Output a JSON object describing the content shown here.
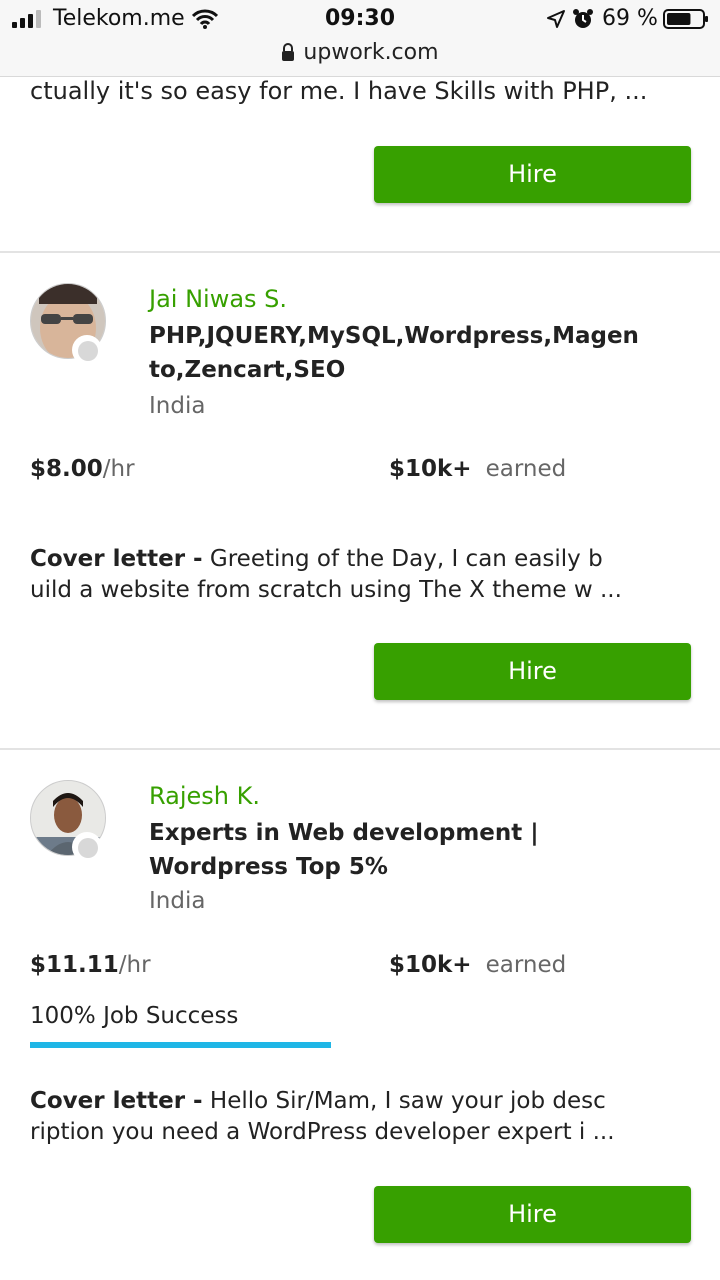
{
  "status_bar": {
    "carrier": "Telekom.me",
    "time": "09:30",
    "battery_percent": "69 %",
    "battery_level": 0.69,
    "icons": [
      "signal-icon",
      "wifi-icon",
      "location-arrow-icon",
      "alarm-icon",
      "battery-icon"
    ]
  },
  "url_bar": {
    "url": "upwork.com",
    "icon": "lock-icon"
  },
  "top_snippet": {
    "text": "ctually it's so easy for me. I have Skills with PHP, ...",
    "hire_label": "Hire"
  },
  "freelancers": [
    {
      "name": "Jai Niwas S.",
      "title_lines": [
        "PHP,JQUERY,MySQL,Wordpress,Magen",
        "to,Zencart,SEO"
      ],
      "country": "India",
      "rate_value": "$8.00",
      "rate_unit": "/hr",
      "earned_value": "$10k+",
      "earned_label": "earned",
      "cover_label": "Cover letter -",
      "cover_line1": "Greeting of the Day, I can easily b",
      "cover_line2": "uild a website from scratch using The X theme w ...",
      "hire_label": "Hire"
    },
    {
      "name": "Rajesh K.",
      "title_lines": [
        "Experts in Web development |",
        "Wordpress Top 5%"
      ],
      "country": "India",
      "rate_value": "$11.11",
      "rate_unit": "/hr",
      "earned_value": "$10k+",
      "earned_label": "earned",
      "job_success": "100% Job Success",
      "job_success_value": 1.0,
      "cover_label": "Cover letter -",
      "cover_line1": "Hello Sir/Mam, I saw your job desc",
      "cover_line2": "ription you need a WordPress developer expert i ...",
      "hire_label": "Hire"
    }
  ],
  "colors": {
    "brand_green": "#37a000",
    "job_success_bar": "#1fb6e6",
    "divider": "#e3e3e3"
  }
}
